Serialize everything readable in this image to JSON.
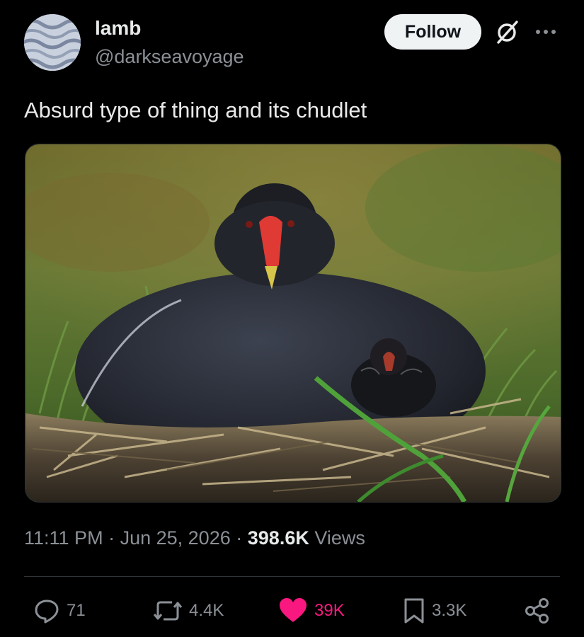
{
  "author": {
    "display_name": "lamb",
    "handle": "@darkseavoyage",
    "avatar_icon": "sand-dunes-avatar"
  },
  "header": {
    "follow_label": "Follow",
    "grok_icon": "grok-icon",
    "more_icon": "more-horizontal-icon"
  },
  "tweet": {
    "text": "Absurd type of thing and its chudlet",
    "media_description_icon": "moorhen-photo"
  },
  "meta": {
    "time": "11:11 PM",
    "separator": "·",
    "date": "Jun 25, 2026",
    "views_count": "398.6K",
    "views_label": "Views"
  },
  "actions": {
    "reply_count": "71",
    "repost_count": "4.4K",
    "like_count": "39K",
    "bookmark_count": "3.3K",
    "like_color": "#f91880",
    "icons": [
      "reply-icon",
      "repost-icon",
      "heart-icon",
      "bookmark-icon",
      "share-icon"
    ]
  }
}
